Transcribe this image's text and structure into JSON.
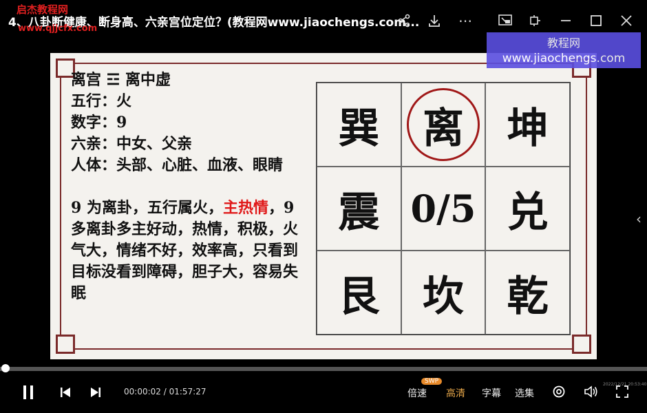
{
  "header": {
    "title": "4、八卦断健康、断身高、六亲宫位定位？(教程网www.jiaochengs.com...",
    "watermark_top": "启杰教程网",
    "watermark_url": "www.qjjcfx.com",
    "share": "share-icon",
    "download": "download-icon",
    "more": "⋯"
  },
  "overlay_watermark": {
    "line1": "教程网",
    "line2": "www.jiaochengs.com"
  },
  "slide": {
    "lines": [
      "离宫 ☲ 离中虚",
      "五行：火",
      "数字：9",
      "六亲：中女、父亲",
      "人体：头部、心脏、血液、眼睛"
    ],
    "para": {
      "before": "9 为离卦，五行属火，",
      "highlight": "主热情",
      "after": "，9 多离卦多主好动，热情，积极，火气大，情绪不好，效率高，只看到目标没看到障碍，胆子大，容易失眠"
    },
    "grid": [
      "巽",
      "离",
      "坤",
      "震",
      "0/5",
      "兑",
      "艮",
      "坎",
      "乾"
    ]
  },
  "player": {
    "current_time": "00:00:02",
    "sep": " / ",
    "total_time": "01:57:27",
    "speed": "倍速",
    "quality": "高清",
    "subtitles": "字幕",
    "episodes": "选集",
    "swp_badge": "SWP",
    "timestamp": "2022/12/21 20:53:40",
    "accent": "#e88a2a"
  }
}
